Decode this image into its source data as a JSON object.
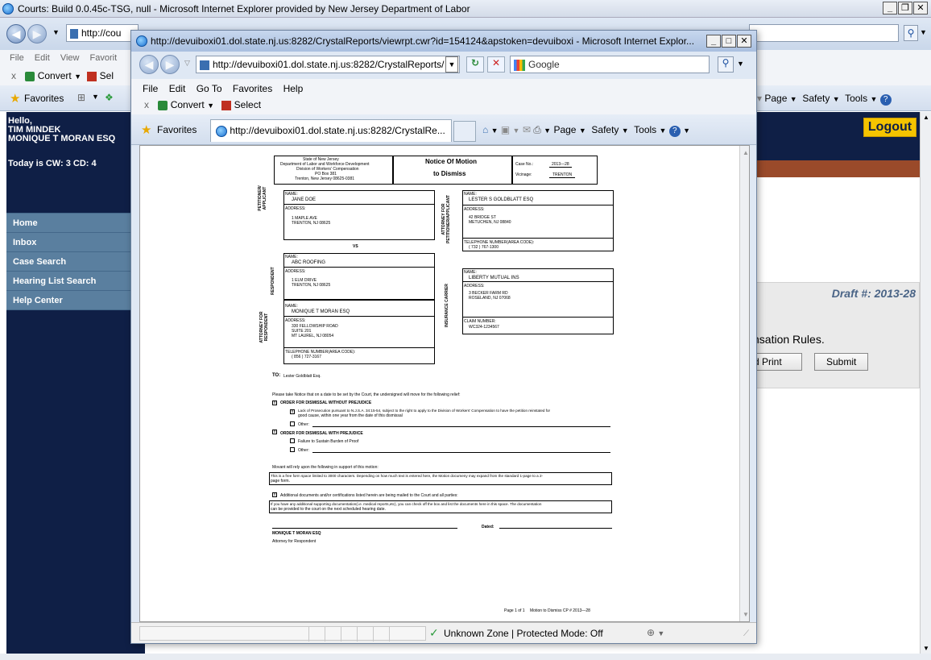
{
  "outer": {
    "title": "Courts: Build 0.0.45c-TSG, null - Microsoft Internet Explorer provided by New Jersey Department of Labor",
    "address": "http://cou",
    "menu": [
      "File",
      "Edit",
      "View",
      "Favorit"
    ],
    "convert": "Convert",
    "select": "Sel",
    "favorites": "Favorites",
    "toolbar_right": [
      "Page",
      "Safety",
      "Tools"
    ]
  },
  "app": {
    "greeting": "Hello,",
    "user": "TIM MINDEK",
    "firm": "MONIQUE T MORAN ESQ",
    "today": "Today is CW: 3 CD: 4",
    "logout": "Logout",
    "nav": [
      "Home",
      "Inbox",
      "Case Search",
      "Hearing List Search",
      "Help Center"
    ],
    "draft": "Draft #: 2013-28",
    "rules_text": "nsation Rules.",
    "print_label": "d Print",
    "submit_label": "Submit"
  },
  "popup": {
    "title": "http://devuiboxi01.dol.state.nj.us:8282/CrystalReports/viewrpt.cwr?id=154124&apstoken=devuiboxi - Microsoft Internet Explor...",
    "address": "http://devuiboxi01.dol.state.nj.us:8282/CrystalReports/",
    "search_placeholder": "Google",
    "menu": [
      "File",
      "Edit",
      "Go To",
      "Favorites",
      "Help"
    ],
    "convert": "Convert",
    "select": "Select",
    "favorites": "Favorites",
    "fav_tab": "http://devuiboxi01.dol.state.nj.us:8282/CrystalRe...",
    "cmd": [
      "Page",
      "Safety",
      "Tools"
    ],
    "status": "Unknown Zone | Protected Mode: Off"
  },
  "doc": {
    "agency": [
      "State of New Jersey",
      "Department of Labor and Workforce Development",
      "Division of Workers' Compensation",
      "PO Box 381",
      "Trenton, New Jersey 08625-0381"
    ],
    "title1": "Notice Of Motion",
    "title2": "to Dismiss",
    "case_no_label": "Case No.:",
    "case_no": "2013—28",
    "vicinage_label": "Vicinage:",
    "vicinage": "TRENTON",
    "petitioner_side": "PETITIONER/ APPLICANT",
    "name_label": "NAME:",
    "address_label": "ADDRESS:",
    "petitioner_name": "JANE DOE",
    "petitioner_addr1": "1 MAPLE AVE",
    "petitioner_addr2": "TRENTON, NJ 08625",
    "vs": "VS",
    "respondent_side": "RESPONDENT",
    "respondent_name": "ABC ROOFING",
    "respondent_addr1": "1 ELM DRIVE",
    "respondent_addr2": "TRENTON, NJ 08625",
    "attorney_resp_side": "ATTORNEY FOR RESPONDENT",
    "attorney_resp_name": "MONIQUE T MORAN ESQ",
    "attorney_resp_addr1": "330 FELLOWSHIP ROAD",
    "attorney_resp_addr2": "SUITE 201",
    "attorney_resp_addr3": "MT LAUREL, NJ 08054",
    "phone_label": "TELEPHONE NUMBER(AREA CODE):",
    "attorney_resp_phone": "( 856 ) 727-3167",
    "attorney_pet_side": "ATTORNEY FOR PETITIONER/APPLICANT",
    "attorney_pet_name": "LESTER S GOLDBLATT ESQ",
    "attorney_pet_addr1": "42 BRIDGE ST",
    "attorney_pet_addr2": "METUCHEN, NJ 08840",
    "attorney_pet_phone": "( 732 ) 767-1300",
    "carrier_side": "INSURANCE CARRIER",
    "carrier_name": "LIBERTY MUTUAL INS",
    "carrier_addr1": "3 BECKER FARM RD",
    "carrier_addr2": "ROSELAND, NJ 07068",
    "claim_label": "CLAIM NUMBER:",
    "claim_no": "WC324-1234567",
    "to_label": "TO:",
    "to_name": "Lester Goldblatt Esq.",
    "notice": "Please take Notice that on a date to be set by the Court, the undersigned will move for the following relief:",
    "order1": "ORDER FOR DISMISSAL WITHOUT PREJUDICE",
    "order1_opt1a": "Lack of Prosecution pursuant to N.J.S.A. 34:15-54, subject to the right to apply to the Division of Workers' Compensation to have the petition reinstated for",
    "order1_opt1b": "good cause, within one year from the date of this dismissal",
    "other": "Other:",
    "order2": "ORDER FOR DISMISSAL WITH PREJUDICE",
    "order2_opt1": "Failure to Sustain Burden of Proof",
    "movant": "Movant will rely upon the following in support of this motion:",
    "freeform1": "This is a free form space limited to 3000 characters. Depending on how much text is entered here, the Motion documeny may expand from the standard  1-page to a 2-",
    "freeform2": "page form.",
    "additional": "Additional documents and/or certifications listed herein are being mailed to the Court and all parties:",
    "addl1": "If you have any additional supporting documentation(i.e. medical reports,etc), you can check off the box and list the documents here in this space.  The  documentation",
    "addl2": "can be provided to the court on the next scheduled hearing date.",
    "dated": "Dated:",
    "signer": "MONIQUE T MORAN ESQ",
    "signer_role": "Attorney for Respondent",
    "footer_page": "Page 1 of 1",
    "footer_id": "Motion to Dismiss CP #  2013—28"
  },
  "colors": {
    "app_sidebar": "#0f1f46",
    "nav_bg": "#5a7f9f",
    "brown_bar": "#9a4a2a",
    "logout": "#f5c400",
    "ie_chrome": "#dfe8f4"
  }
}
